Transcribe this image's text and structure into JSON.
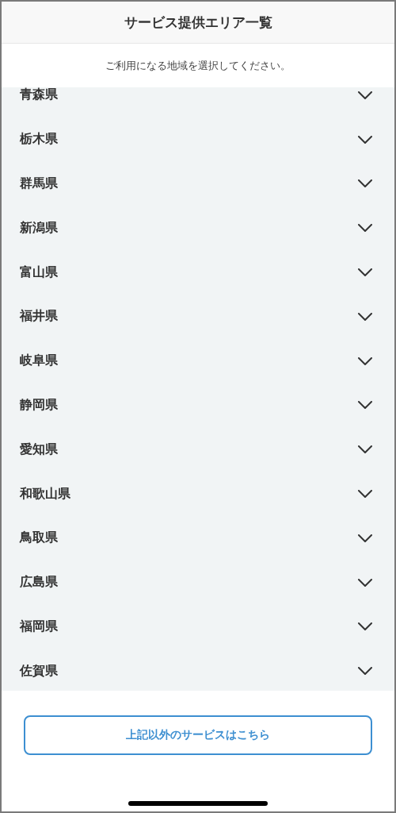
{
  "header": {
    "title": "サービス提供エリア一覧"
  },
  "instruction": "ご利用になる地域を選択してください。",
  "regions": [
    {
      "name": "青森県",
      "expanded": false
    },
    {
      "name": "栃木県",
      "expanded": false
    },
    {
      "name": "群馬県",
      "expanded": false
    },
    {
      "name": "新潟県",
      "expanded": false
    },
    {
      "name": "富山県",
      "expanded": false
    },
    {
      "name": "福井県",
      "expanded": false
    },
    {
      "name": "岐阜県",
      "expanded": false
    },
    {
      "name": "静岡県",
      "expanded": false
    },
    {
      "name": "愛知県",
      "expanded": false
    },
    {
      "name": "和歌山県",
      "expanded": false
    },
    {
      "name": "鳥取県",
      "expanded": false
    },
    {
      "name": "広島県",
      "expanded": false
    },
    {
      "name": "福岡県",
      "expanded": false
    },
    {
      "name": "佐賀県",
      "expanded": false
    }
  ],
  "other_services_button": "上記以外のサービスはこちら"
}
